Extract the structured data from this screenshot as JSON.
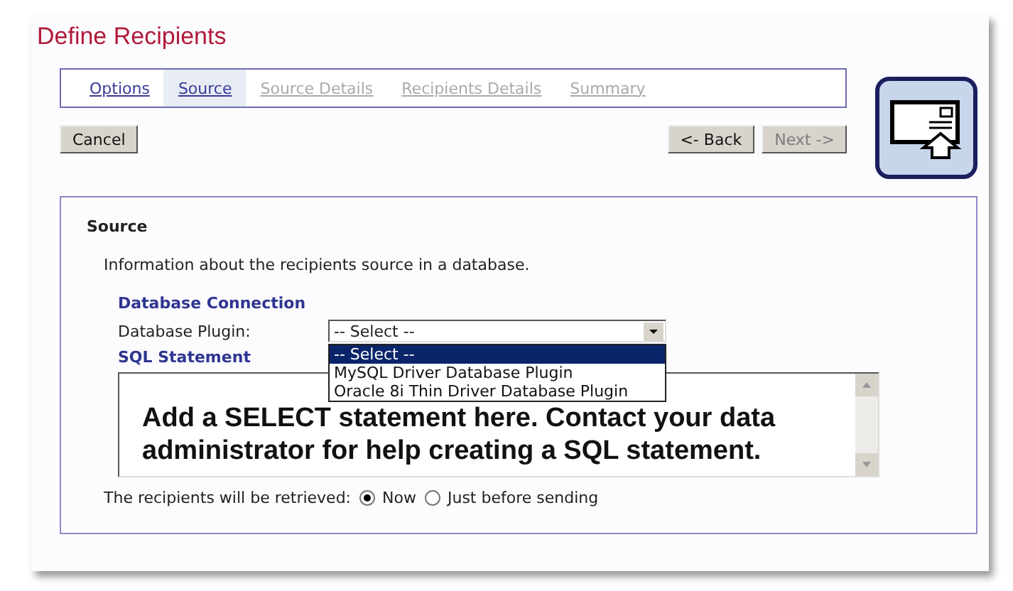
{
  "title": "Define Recipients",
  "steps": [
    {
      "label": "Options",
      "selected": false,
      "disabled": false
    },
    {
      "label": "Source",
      "selected": true,
      "disabled": false
    },
    {
      "label": "Source Details",
      "selected": false,
      "disabled": true
    },
    {
      "label": "Recipients Details",
      "selected": false,
      "disabled": true
    },
    {
      "label": "Summary",
      "selected": false,
      "disabled": true
    }
  ],
  "cancel_button": "Cancel",
  "nav_buttons": [
    {
      "label": "<- Back",
      "disabled": false
    },
    {
      "label": "Next ->",
      "disabled": true
    }
  ],
  "section": {
    "heading": "Source",
    "description": "Information about the recipients source in a database.",
    "connection_heading": "Database Connection",
    "plugin_label": "Database Plugin:",
    "plugin_value": "-- Select --",
    "plugin_options": [
      {
        "label": "-- Select --",
        "selected": true
      },
      {
        "label": "MySQL Driver Database Plugin",
        "selected": false
      },
      {
        "label": "Oracle 8i Thin Driver Database Plugin",
        "selected": false
      }
    ],
    "sql_heading": "SQL Statement",
    "sql_value": "Add a SELECT statement here. Contact your data administrator for help creating a SQL statement.",
    "retrieve_label": "The recipients will be retrieved:",
    "retrieve_options": [
      {
        "label": "Now",
        "selected": true
      },
      {
        "label": "Just before sending",
        "selected": false
      }
    ]
  }
}
